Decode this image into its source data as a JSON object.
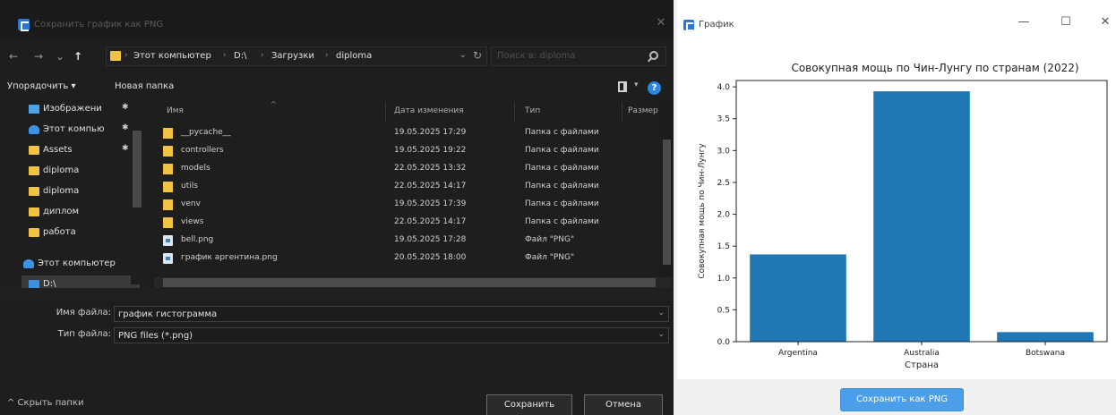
{
  "dialog": {
    "title": "Сохранить график как PNG",
    "close_glyph": "✕",
    "nav": {
      "back": "←",
      "forward": "→",
      "recent": "⌄",
      "up": "↑"
    },
    "breadcrumb": [
      "Этот компьютер",
      "D:\\",
      "Загрузки",
      "diploma"
    ],
    "breadcrumb_separator": "›",
    "address_dropdown": "⌄",
    "refresh_glyph": "↻",
    "search_placeholder": "Поиск в: diploma",
    "commands": {
      "organize": "Упорядочить ▾",
      "new_folder": "Новая папка",
      "view_dropdown": "▾",
      "help": "?"
    },
    "sidebar": [
      {
        "label": "Изображени",
        "icon": "pictures-icon",
        "pinned": true
      },
      {
        "label": "Этот компью",
        "icon": "computer-icon",
        "pinned": true
      },
      {
        "label": "Assets",
        "icon": "folder-icon",
        "pinned": true
      },
      {
        "label": "diploma",
        "icon": "folder-icon",
        "pinned": false
      },
      {
        "label": "diploma",
        "icon": "folder-icon",
        "pinned": false
      },
      {
        "label": "диплом",
        "icon": "folder-icon",
        "pinned": false
      },
      {
        "label": "работа",
        "icon": "folder-icon",
        "pinned": false
      },
      {
        "label": "Этот компьютер",
        "icon": "computer-icon",
        "pinned": false
      },
      {
        "label": "D:\\",
        "icon": "drive-icon",
        "pinned": false
      }
    ],
    "pin_glyph": "✱",
    "columns": {
      "name": "Имя",
      "date": "Дата изменения",
      "type": "Тип",
      "size": "Размер"
    },
    "files": [
      {
        "name": "__pycache__",
        "date": "19.05.2025 17:29",
        "type": "Папка с файлами",
        "kind": "folder"
      },
      {
        "name": "controllers",
        "date": "19.05.2025 19:22",
        "type": "Папка с файлами",
        "kind": "folder"
      },
      {
        "name": "models",
        "date": "22.05.2025 13:32",
        "type": "Папка с файлами",
        "kind": "folder"
      },
      {
        "name": "utils",
        "date": "22.05.2025 14:17",
        "type": "Папка с файлами",
        "kind": "folder"
      },
      {
        "name": "venv",
        "date": "19.05.2025 17:39",
        "type": "Папка с файлами",
        "kind": "folder"
      },
      {
        "name": "views",
        "date": "22.05.2025 14:17",
        "type": "Папка с файлами",
        "kind": "folder"
      },
      {
        "name": "bell.png",
        "date": "19.05.2025 17:28",
        "type": "Файл \"PNG\"",
        "kind": "file"
      },
      {
        "name": "график аргентина.png",
        "date": "20.05.2025 18:00",
        "type": "Файл \"PNG\"",
        "kind": "file"
      }
    ],
    "filename_label": "Имя файла:",
    "filename_value": "график гистограмма",
    "filetype_label": "Тип файла:",
    "filetype_value": "PNG files (*.png)",
    "field_caret": "⌄",
    "hide_folders": "^ Скрыть папки",
    "save_button": "Сохранить",
    "cancel_button": "Отмена"
  },
  "chart_window": {
    "title": "График",
    "minimize": "—",
    "maximize": "☐",
    "close": "✕",
    "save_button": "Сохранить как PNG"
  },
  "colors": {
    "bar": "#1f77b4",
    "save_button": "#4a9eea",
    "dialog_bg": "#1e1e1e"
  },
  "chart_data": {
    "type": "bar",
    "title": "Совокупная мощь по Чин-Лунгу по странам (2022)",
    "xlabel": "Страна",
    "ylabel": "Совокупная мощь по Чин-Лунгу",
    "categories": [
      "Argentina",
      "Australia",
      "Botswana"
    ],
    "values": [
      1.37,
      3.93,
      0.15
    ],
    "ylim": [
      0,
      4.1
    ],
    "yticks": [
      "0.0",
      "0.5",
      "1.0",
      "1.5",
      "2.0",
      "2.5",
      "3.0",
      "3.5",
      "4.0"
    ],
    "grid": false
  }
}
